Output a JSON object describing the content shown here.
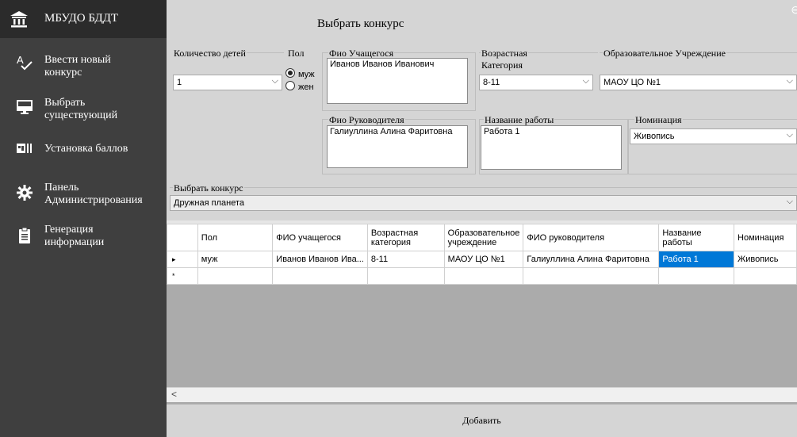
{
  "sidebar": {
    "app_title": "МБУДО БДДТ",
    "items": [
      {
        "label": "Ввести новый\nконкурс",
        "icon": "spell-check-icon"
      },
      {
        "label": "Выбрать\nсуществующий",
        "icon": "monitor-icon"
      },
      {
        "label": "Установка баллов",
        "icon": "scoreboard-icon"
      },
      {
        "label": "Панель\nАдминистрирования",
        "icon": "gear-icon"
      },
      {
        "label": "Генерация\nинформации",
        "icon": "clipboard-icon"
      }
    ],
    "colors": {
      "background": "#3f3f3f",
      "header": "#2b2b2b"
    }
  },
  "form": {
    "title": "Выбрать конкурс",
    "children_count": {
      "label": "Количество детей",
      "value": "1"
    },
    "gender": {
      "label": "Пол",
      "options": [
        "муж",
        "жен"
      ],
      "selected": "муж"
    },
    "student_name": {
      "label": "Фио Учащегося",
      "value": "Иванов Иванов Иванович"
    },
    "age_category": {
      "label": "Возрастная\nКатегория",
      "value": "8-11"
    },
    "institution": {
      "label": "Образовательное Учреждение",
      "value": "МАОУ ЦО №1"
    },
    "supervisor_name": {
      "label": "Фио Руководителя",
      "value": "Галиуллина Алина Фаритовна"
    },
    "work_title": {
      "label": "Название работы",
      "value": "Работа 1"
    },
    "nomination": {
      "label": "Номинация",
      "value": "Живопись"
    },
    "contest": {
      "label": "Выбрать конкурс",
      "value": "Дружная планета"
    }
  },
  "grid": {
    "columns": [
      "Пол",
      "ФИО учащегося",
      "Возрастная категория",
      "Образовательное учреждение",
      "ФИО руководителя",
      "Название работы",
      "Номинация"
    ],
    "rows": [
      [
        "муж",
        "Иванов Иванов Ива...",
        "8-11",
        "МАОУ ЦО №1",
        "Галиуллина Алина Фаритовна",
        "Работа 1",
        "Живопись"
      ]
    ],
    "selected_cell": {
      "row": 0,
      "col": 5
    },
    "row_markers": {
      "current": "▸",
      "new": "*"
    }
  },
  "footer": {
    "add_label": "Добавить"
  }
}
